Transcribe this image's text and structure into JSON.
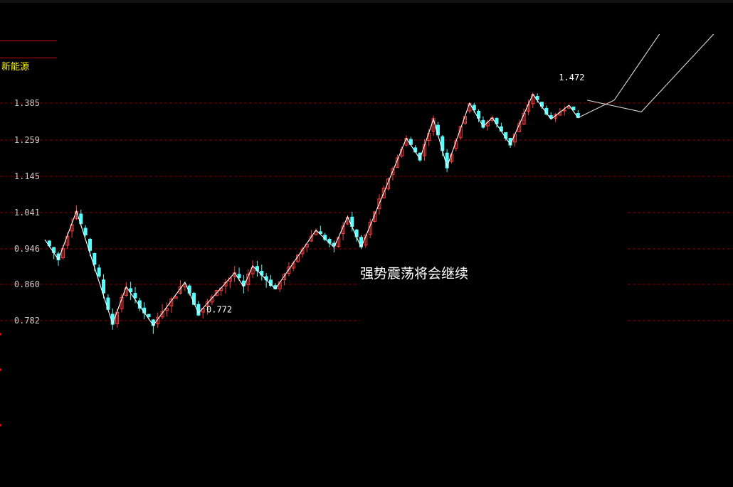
{
  "symbol_label": "新能源",
  "annotation": "强势震荡将会继续",
  "colors": {
    "up": "#ff3b3b",
    "down": "#54ffff",
    "grid": "#8b0000",
    "zigzag": "#ffffff",
    "symbol": "#ffff00"
  },
  "chart_data": {
    "type": "candlestick",
    "y_ticks": [
      "1.385",
      "1.259",
      "1.145",
      "1.041",
      "0.946",
      "0.860",
      "0.782"
    ],
    "ylim": [
      0.74,
      1.51
    ],
    "grid": true,
    "point_labels": [
      {
        "text": "0.772",
        "index": 20,
        "value": 0.772
      },
      {
        "text": "1.472",
        "index": 98,
        "value": 1.472
      }
    ],
    "zigzag_pivots": [
      {
        "index": 0,
        "value": 0.97
      },
      {
        "index": 3,
        "value": 0.92
      },
      {
        "index": 7,
        "value": 1.045
      },
      {
        "index": 15,
        "value": 0.775
      },
      {
        "index": 18,
        "value": 0.855
      },
      {
        "index": 24,
        "value": 0.772
      },
      {
        "index": 31,
        "value": 0.865
      },
      {
        "index": 34,
        "value": 0.798
      },
      {
        "index": 42,
        "value": 0.888
      },
      {
        "index": 44,
        "value": 0.855
      },
      {
        "index": 46,
        "value": 0.905
      },
      {
        "index": 51,
        "value": 0.85
      },
      {
        "index": 60,
        "value": 0.995
      },
      {
        "index": 64,
        "value": 0.95
      },
      {
        "index": 67,
        "value": 1.03
      },
      {
        "index": 70,
        "value": 0.95
      },
      {
        "index": 80,
        "value": 1.265
      },
      {
        "index": 83,
        "value": 1.2
      },
      {
        "index": 86,
        "value": 1.33
      },
      {
        "index": 89,
        "value": 1.175
      },
      {
        "index": 94,
        "value": 1.385
      },
      {
        "index": 97,
        "value": 1.305
      },
      {
        "index": 99,
        "value": 1.335
      },
      {
        "index": 103,
        "value": 1.245
      },
      {
        "index": 108,
        "value": 1.415
      },
      {
        "index": 112,
        "value": 1.33
      },
      {
        "index": 116,
        "value": 1.378
      },
      {
        "index": 118,
        "value": 1.335
      }
    ],
    "projection_lines": [
      [
        [
          118,
          1.335
        ],
        [
          126,
          1.395
        ],
        [
          136,
          1.62
        ]
      ],
      [
        [
          120,
          1.395
        ],
        [
          132,
          1.355
        ],
        [
          148,
          1.62
        ]
      ]
    ]
  }
}
